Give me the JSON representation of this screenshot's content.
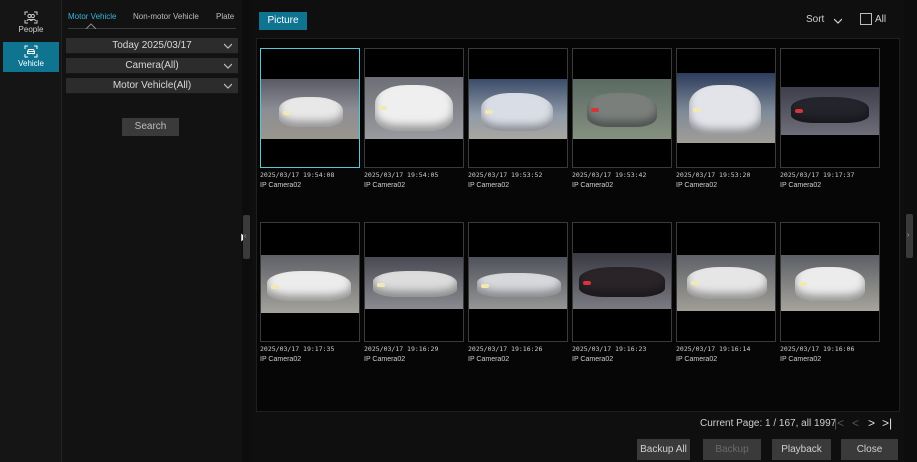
{
  "rail": {
    "items": [
      {
        "label": "People",
        "icon": "people-icon",
        "active": false
      },
      {
        "label": "Vehicle",
        "icon": "vehicle-icon",
        "active": true
      }
    ]
  },
  "filter": {
    "tabs": [
      "Motor Vehicle",
      "Non-motor Vehicle",
      "Plate"
    ],
    "active_tab": "Motor Vehicle",
    "date": "Today 2025/03/17",
    "camera": "Camera(All)",
    "type": "Motor Vehicle(All)",
    "search_label": "Search"
  },
  "toolbar": {
    "view_label": "Picture",
    "sort_label": "Sort",
    "all_label": "All"
  },
  "results": [
    {
      "time": "2025/03/17 19:54:08",
      "camera": "IP Camera02",
      "selected": true
    },
    {
      "time": "2025/03/17 19:54:05",
      "camera": "IP Camera02",
      "selected": false
    },
    {
      "time": "2025/03/17 19:53:52",
      "camera": "IP Camera02",
      "selected": false
    },
    {
      "time": "2025/03/17 19:53:42",
      "camera": "IP Camera02",
      "selected": false
    },
    {
      "time": "2025/03/17 19:53:20",
      "camera": "IP Camera02",
      "selected": false
    },
    {
      "time": "2025/03/17 19:17:37",
      "camera": "IP Camera02",
      "selected": false
    },
    {
      "time": "2025/03/17 19:17:35",
      "camera": "IP Camera02",
      "selected": false
    },
    {
      "time": "2025/03/17 19:16:29",
      "camera": "IP Camera02",
      "selected": false
    },
    {
      "time": "2025/03/17 19:16:26",
      "camera": "IP Camera02",
      "selected": false
    },
    {
      "time": "2025/03/17 19:16:23",
      "camera": "IP Camera02",
      "selected": false
    },
    {
      "time": "2025/03/17 19:16:14",
      "camera": "IP Camera02",
      "selected": false
    },
    {
      "time": "2025/03/17 19:16:06",
      "camera": "IP Camera02",
      "selected": false
    }
  ],
  "pagination": {
    "text": "Current Page: 1 / 167, all 1997",
    "first": "|<",
    "prev": "<",
    "next": ">",
    "last": ">|"
  },
  "actions": {
    "backup_all": "Backup All",
    "backup": "Backup",
    "playback": "Playback",
    "close": "Close"
  },
  "colors": {
    "accent": "#0e7490",
    "active_tab_text": "#38b6d8",
    "selected_border": "#59c6d6"
  }
}
